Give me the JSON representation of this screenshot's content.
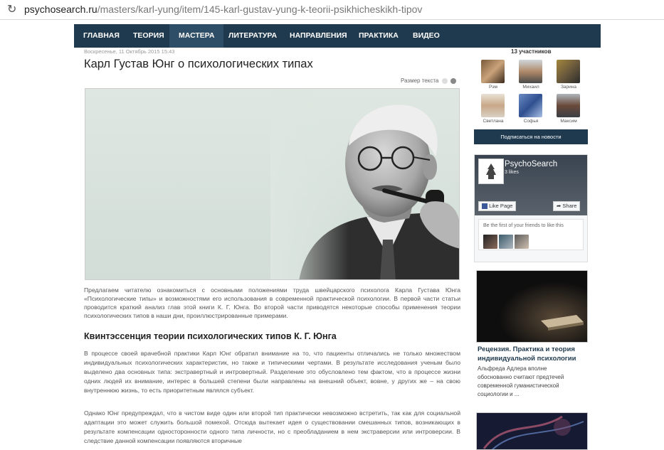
{
  "browser": {
    "reload_icon": "reload-icon",
    "url_host": "psychosearch.ru",
    "url_path": "/masters/karl-yung/item/145-karl-gustav-yung-k-teorii-psikhicheskikh-tipov"
  },
  "nav": [
    "ГЛАВНАЯ",
    "ТЕОРИЯ",
    "МАСТЕРА",
    "ЛИТЕРАТУРА",
    "НАПРАВЛЕНИЯ",
    "ПРАКТИКА",
    "ВИДЕО"
  ],
  "article": {
    "date": "Воскресенье, 11 Октябрь 2015 15:43",
    "title": "Карл Густав Юнг о психологических типах",
    "text_size_label": "Размер текста",
    "intro": "Предлагаем читателю ознакомиться с основными положениями труда швейцарского психолога Карла Густава Юнга «Психологические типы» и возможностями его использования в современной практической психологии. В первой части статьи проводится краткий анализ глав этой книги К. Г. Юнга. Во второй части приводятся некоторые способы применения теории психологических типов в наши дни, проиллюстрированные примерами.",
    "section_heading": "Квинтэссенция теории психологических типов К. Г. Юнга",
    "para1": "В процессе своей врачебной практики Карл Юнг обратил внимание на то, что пациенты отличались не только множеством индивидуальных психологических характеристик, но также и типическими чертами. В результате исследования ученым было выделено два основных типа: экстравертный и интровертный. Разделение это  обусловлено тем фактом, что в процессе жизни одних людей их внимание, интерес в большей степени были направлены на внешний объект, вовне, у других же – на свою внутреннюю жизнь, то есть приоритетным являлся субъект.",
    "para2": "Однако Юнг предупреждал, что в чистом виде один или второй тип практически невозможно встретить, так как для социальной адаптации это может служить большой помехой. Отсюда вытекает идея о существовании смешанных типов, возникающих в результате компенсации односторонности одного типа личности, но с преобладанием в нем экстраверсии или интроверсии. В следствие данной компенсации появляются вторичные"
  },
  "sidebar": {
    "members_title": "13 участников",
    "members": [
      "Рэм",
      "Михаил",
      "Зарина",
      "Светлана",
      "Софья",
      "Максим"
    ],
    "subscribe_label": "Подписаться на новости",
    "fb": {
      "page_name": "PsychoSearch",
      "likes": "3 likes",
      "like_button": "Like Page",
      "share_button": "Share",
      "friends_text": "Be the first of your friends to like this"
    },
    "card": {
      "title": "Рецензия. Практика и теория индивидуальной психологии",
      "text": "Альфреда Адлера вполне обоснованно считают предтечей современной гуманистической социологии и ..."
    }
  }
}
